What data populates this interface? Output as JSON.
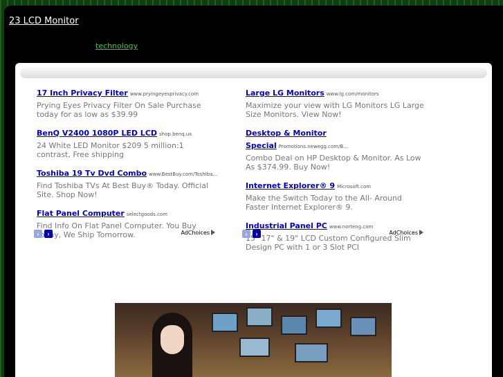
{
  "header": {
    "site_title": "23 LCD Monitor",
    "category_link": "technology"
  },
  "ads_left": [
    {
      "title": "17 Inch Privacy Filter",
      "url": "www.pryingeyesprivacy.com",
      "desc": "Prying Eyes Privacy Filter On Sale Purchase today for as low as $39.99"
    },
    {
      "title": "BenQ V2400 1080P LED LCD",
      "url": "shop.benq.us",
      "desc": "24 White LED Monitor $209 5 million:1 contrast, Free shipping"
    },
    {
      "title": "Toshiba 19 Tv Dvd Combo",
      "url": "www.BestBuy.com/Toshiba...",
      "desc": "Find Toshiba TVs At Best Buy® Today. Official Site. Shop Now!"
    },
    {
      "title": "Flat Panel Computer",
      "url": "selectgoods.com",
      "desc": "Find Info On Flat Panel Computer. You Buy Today, We Ship Tomorrow."
    }
  ],
  "ads_right": [
    {
      "title": "Large LG Monitors",
      "url": "www.lg.com/monitors",
      "desc": "Maximize your view with LG Monitors LG Large Size Monitors. View Now!"
    },
    {
      "title": "Desktop & Monitor Special",
      "url": "Promotions.newegg.com/B...",
      "desc": "Combo Deal on HP Desktop & Monitor. As Low As $374.99. Buy Now!"
    },
    {
      "title": "Internet Explorer® 9",
      "url": "Microsoft.com",
      "desc": "Make the Switch Today to the All- Around Faster Internet Explorer® 9."
    },
    {
      "title": "Industrial Panel PC",
      "url": "www.norteng.com",
      "desc": "15\" 17\" & 19\" LCD Custom Configured Slim Design PC with 1 or 3 Slot PCI"
    }
  ],
  "ad_nav": {
    "prev_glyph": "‹",
    "next_glyph": "›",
    "adchoices_label": "AdChoices"
  }
}
